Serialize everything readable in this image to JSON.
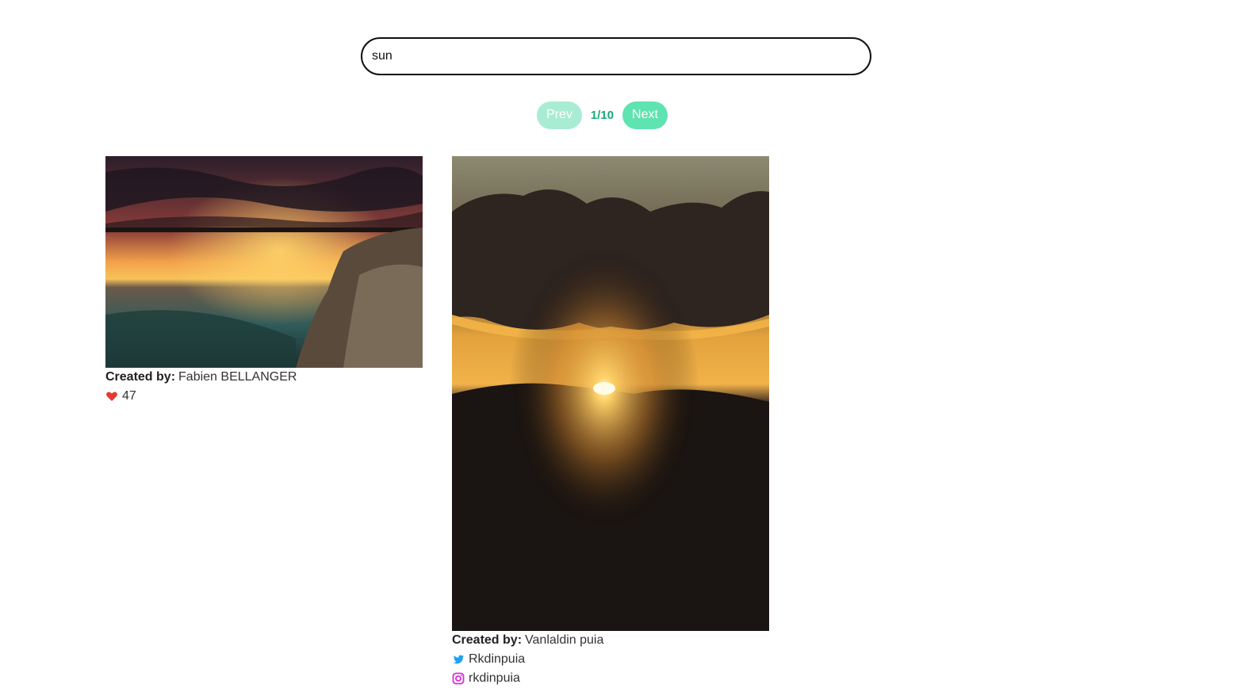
{
  "search": {
    "value": "sun",
    "placeholder": ""
  },
  "pagination": {
    "prev_label": "Prev",
    "next_label": "Next",
    "page_indicator": "1/10"
  },
  "colors": {
    "accent": "#5fe3b0",
    "accent_disabled": "#a8ecd4",
    "accent_text": "#1aa97a",
    "heart": "#e53935",
    "twitter": "#1da1f2",
    "instagram": "#d62ed6"
  },
  "results": [
    {
      "photo_icon": "sunset-over-rocky-shore-photo",
      "created_by_label": "Created by:",
      "author": "Fabien BELLANGER",
      "likes": "47",
      "likes_icon": "heart-icon"
    },
    {
      "photo_icon": "sunburst-over-mountain-photo",
      "created_by_label": "Created by:",
      "author": "Vanlaldin puia",
      "twitter": "Rkdinpuia",
      "twitter_icon": "twitter-icon",
      "instagram": "rkdinpuia",
      "instagram_icon": "instagram-icon"
    }
  ]
}
